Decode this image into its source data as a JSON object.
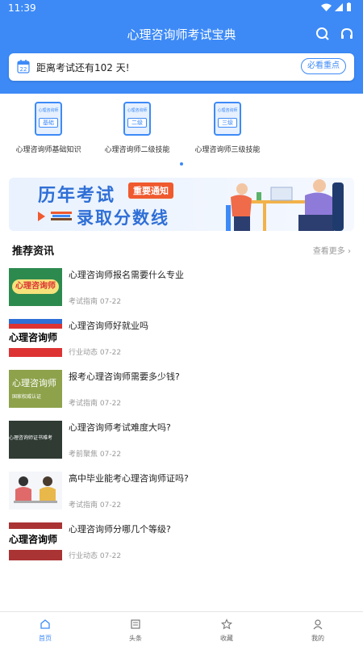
{
  "status_bar": {
    "time": "11:39"
  },
  "header": {
    "title": "心理咨询师考试宝典"
  },
  "countdown": {
    "text": "距离考试还有102 天!",
    "calendar_day": "22",
    "button_label": "必看重点"
  },
  "categories": [
    {
      "book_top": "心理咨询师",
      "book_label": "基础",
      "label": "心理咨询师基础知识"
    },
    {
      "book_top": "心理咨询师",
      "book_label": "二级",
      "label": "心理咨询师二级技能"
    },
    {
      "book_top": "心理咨询师",
      "book_label": "三级",
      "label": "心理咨询师三级技能"
    }
  ],
  "banner": {
    "line1": "历年考试",
    "tag": "重要通知",
    "line2": "录取分数线"
  },
  "recommend": {
    "title": "推荐资讯",
    "more": "查看更多 ›"
  },
  "news": [
    {
      "title": "心理咨询师报名需要什么专业",
      "category": "考试指南",
      "date": "07-22",
      "thumb_text": "心理咨询师",
      "thumb_sub": ""
    },
    {
      "title": "心理咨询师好就业吗",
      "category": "行业动态",
      "date": "07-22",
      "thumb_text": "心理咨询师",
      "thumb_sub": ""
    },
    {
      "title": "报考心理咨询师需要多少钱?",
      "category": "考试指南",
      "date": "07-22",
      "thumb_text": "心理咨询师",
      "thumb_sub": "国家权威认证"
    },
    {
      "title": "心理咨询师考试难度大吗?",
      "category": "考前聚焦",
      "date": "07-22",
      "thumb_text": "心理咨询师证书难考",
      "thumb_sub": ""
    },
    {
      "title": "高中毕业能考心理咨询师证吗?",
      "category": "考试指南",
      "date": "07-22",
      "thumb_text": "",
      "thumb_sub": ""
    },
    {
      "title": "心理咨询师分哪几个等级?",
      "category": "行业动态",
      "date": "07-22",
      "thumb_text": "心理咨询师",
      "thumb_sub": ""
    }
  ],
  "tabs": [
    {
      "label": "首页",
      "icon": "home-icon",
      "active": true
    },
    {
      "label": "头条",
      "icon": "news-icon",
      "active": false
    },
    {
      "label": "收藏",
      "icon": "star-icon",
      "active": false
    },
    {
      "label": "我的",
      "icon": "user-icon",
      "active": false
    }
  ],
  "colors": {
    "primary": "#3d8af7",
    "accent": "#ef5a2f"
  }
}
